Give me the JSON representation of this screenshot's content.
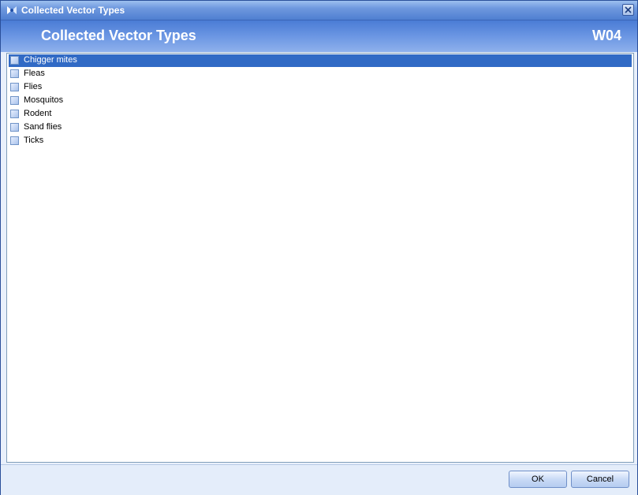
{
  "window": {
    "title": "Collected Vector Types",
    "close_icon": "close-icon",
    "app_icon": "app-logo-icon"
  },
  "header": {
    "title": "Collected Vector Types",
    "code": "W04"
  },
  "list": {
    "selected_index": 0,
    "items": [
      {
        "label": "Chigger mites",
        "checked": false
      },
      {
        "label": "Fleas",
        "checked": false
      },
      {
        "label": "Flies",
        "checked": false
      },
      {
        "label": "Mosquitos",
        "checked": false
      },
      {
        "label": "Rodent",
        "checked": false
      },
      {
        "label": "Sand flies",
        "checked": false
      },
      {
        "label": "Ticks",
        "checked": false
      }
    ]
  },
  "footer": {
    "ok_label": "OK",
    "cancel_label": "Cancel"
  },
  "colors": {
    "selection": "#316ac5",
    "header_blue": "#4a7cd5"
  }
}
